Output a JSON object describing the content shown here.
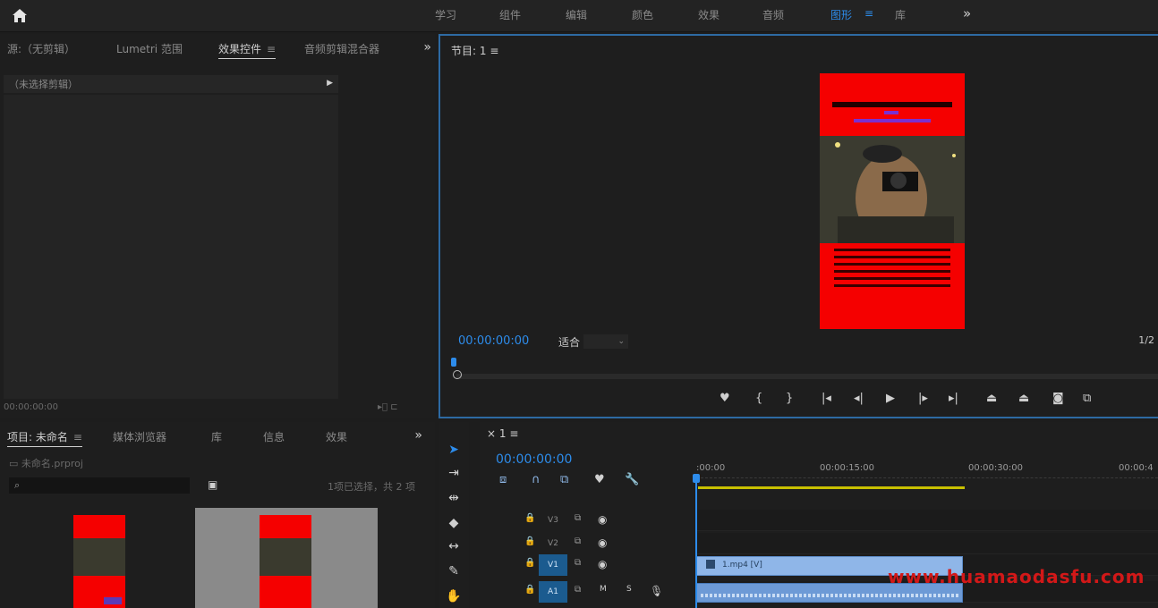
{
  "topbar": {
    "workspaces": [
      "学习",
      "组件",
      "编辑",
      "颜色",
      "效果",
      "音频",
      "图形",
      "库"
    ],
    "active_workspace": "图形",
    "menu_glyph": "≡",
    "more_glyph": "»"
  },
  "source_panel": {
    "tabs": [
      "源:（无剪辑）",
      "Lumetri 范围",
      "效果控件",
      "音频剪辑混合器"
    ],
    "active_tab": "效果控件",
    "menu_glyph": "≡",
    "clip_header": "（未选择剪辑）",
    "timecode": "00:00:00:00"
  },
  "program_monitor": {
    "title": "节目: 1",
    "menu_glyph": "≡",
    "timecode": "00:00:00:00",
    "fit_label": "适合",
    "ratio": "1/2",
    "controls": [
      "marker-icon",
      "in-point-icon",
      "out-point-icon",
      "goto-in-icon",
      "step-back-icon",
      "play-icon",
      "step-forward-icon",
      "goto-out-icon",
      "lift-icon",
      "extract-icon",
      "export-frame-icon",
      "compare-icon"
    ]
  },
  "project_panel": {
    "tabs": [
      "项目: 未命名",
      "媒体浏览器",
      "库",
      "信息",
      "效果"
    ],
    "active_tab": "项目: 未命名",
    "file_name": "未命名.prproj",
    "search_placeholder": "",
    "selection_count": "1项已选择，共 2 项"
  },
  "timeline": {
    "sequence_tab": "1",
    "timecode": "00:00:00:00",
    "ruler": [
      ":00:00",
      "00:00:15:00",
      "00:00:30:00",
      "00:00:4"
    ],
    "tracks": [
      {
        "name": "V3",
        "type": "video",
        "selected": false,
        "clip": null
      },
      {
        "name": "V2",
        "type": "video",
        "selected": false,
        "clip": null
      },
      {
        "name": "V1",
        "type": "video",
        "selected": true,
        "clip": "1.mp4 [V]"
      },
      {
        "name": "A1",
        "type": "audio",
        "selected": true,
        "clip": ""
      }
    ],
    "audio_track_buttons": [
      "M",
      "S"
    ]
  },
  "watermark": "www.huamaodasfu.com",
  "colors": {
    "accent": "#2d8ceb",
    "frame_red": "#f50000",
    "work_area": "#c8c000",
    "clip_blue": "#8fb6e8",
    "selected_track": "#1b5b8f"
  }
}
